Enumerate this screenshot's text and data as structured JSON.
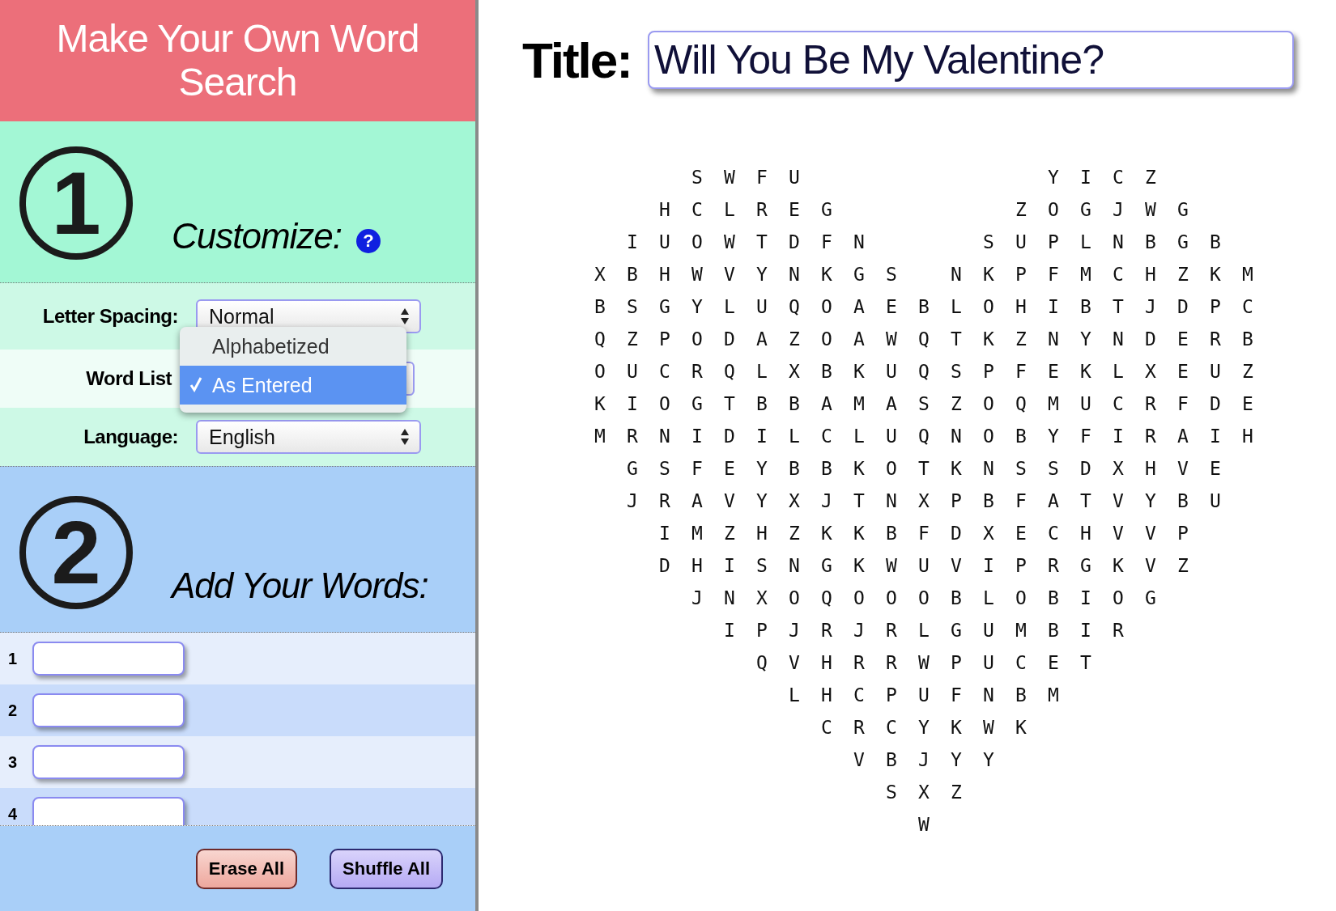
{
  "header": {
    "title": "Make Your Own Word Search"
  },
  "step1": {
    "number": "1",
    "heading": "Customize:",
    "help": "?"
  },
  "settings": [
    {
      "kind": "select",
      "label": "Letter Spacing:",
      "value": "Normal"
    },
    {
      "kind": "open-select",
      "label": "Word List",
      "options": [
        {
          "label": "Alphabetized",
          "selected": false
        },
        {
          "label": "As Entered",
          "selected": true
        }
      ]
    },
    {
      "kind": "select",
      "label": "Language:",
      "value": "English"
    }
  ],
  "step2": {
    "number": "2",
    "heading": "Add Your Words:"
  },
  "word_rows": [
    {
      "number": "1"
    },
    {
      "number": "2"
    },
    {
      "number": "3"
    },
    {
      "number": "4"
    }
  ],
  "buttons": [
    {
      "kind": "erase",
      "label": "Erase All"
    },
    {
      "kind": "shuffle",
      "label": "Shuffle All"
    }
  ],
  "puzzle": {
    "title_label": "Title:",
    "title_value": "Will You Be My Valentine?",
    "grid": [
      "S W F U               Y I C Z",
      "H C L R E G           Z O G J W G",
      "I U O W T D F N       S U P L N B G B",
      "X B H W V Y N K G S   N K P F M C H Z K M",
      "B S G Y L U Q O A E B L O H I B T J D P C",
      "Q Z P O D A Z O A W Q T K Z N Y N D E R B",
      "O U C R Q L X B K U Q S P F E K L X E U Z",
      "K I O G T B B A M A S Z O Q M U C R F D E",
      "M R N I D I L C L U Q N O B Y F I R A I H",
      "G S F E Y B B K O T K N S S D X H V E",
      "J R A V Y X J T N X P B F A T V Y B U",
      "I M Z H Z K K B F D X E C H V V P",
      "D H I S N G K W U V I P R G K V Z",
      "J N X O Q O O O B L O B I O G",
      "I P J R J R L G U M B I R",
      "Q V H R R W P U C E T",
      "L H C P U F N B M",
      "C R C Y K W K",
      "V B J Y Y",
      "S X Z",
      "W"
    ]
  }
}
